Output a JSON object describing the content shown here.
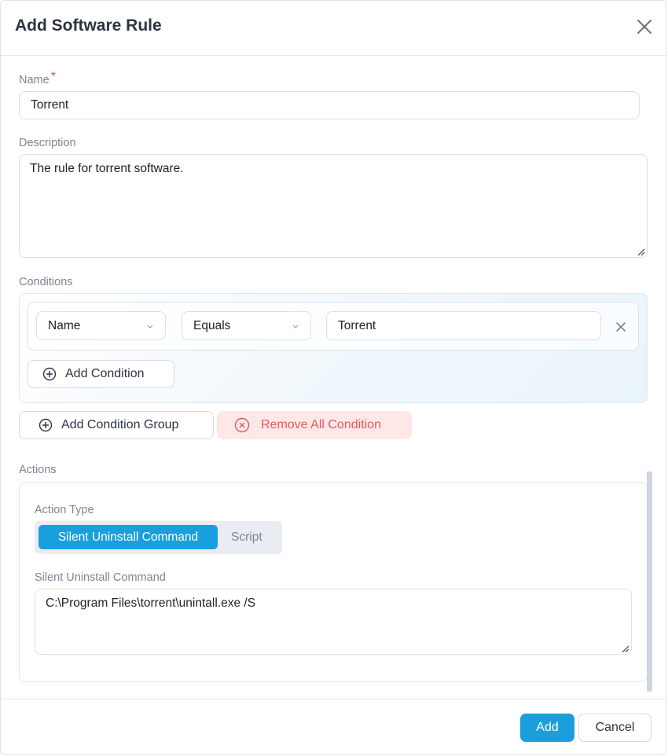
{
  "dialog": {
    "title": "Add Software Rule"
  },
  "name_field": {
    "label": "Name",
    "required_mark": "*",
    "value": "Torrent"
  },
  "description_field": {
    "label": "Description",
    "value": "The rule for torrent software."
  },
  "conditions": {
    "label": "Conditions",
    "rows": [
      {
        "field": "Name",
        "operator": "Equals",
        "value": "Torrent"
      }
    ],
    "add_condition_label": "Add Condition",
    "add_group_label": "Add Condition Group",
    "remove_all_label": "Remove All Condition"
  },
  "actions": {
    "label": "Actions",
    "action_type_label": "Action Type",
    "action_type_options": [
      "Silent Uninstall Command",
      "Script"
    ],
    "action_type_selected": "Silent Uninstall Command",
    "command_label": "Silent Uninstall Command",
    "command_value": "C:\\Program Files\\torrent\\unintall.exe /S"
  },
  "footer": {
    "add_label": "Add",
    "cancel_label": "Cancel"
  },
  "colors": {
    "primary": "#1b9fdc",
    "danger_bg": "#fde7e7",
    "danger_text": "#e25c5c",
    "required": "#e5484d"
  },
  "icons": {
    "close": "close-icon",
    "chevron": "chevron-down-icon",
    "add": "plus-circle-icon",
    "remove": "x-circle-icon"
  }
}
